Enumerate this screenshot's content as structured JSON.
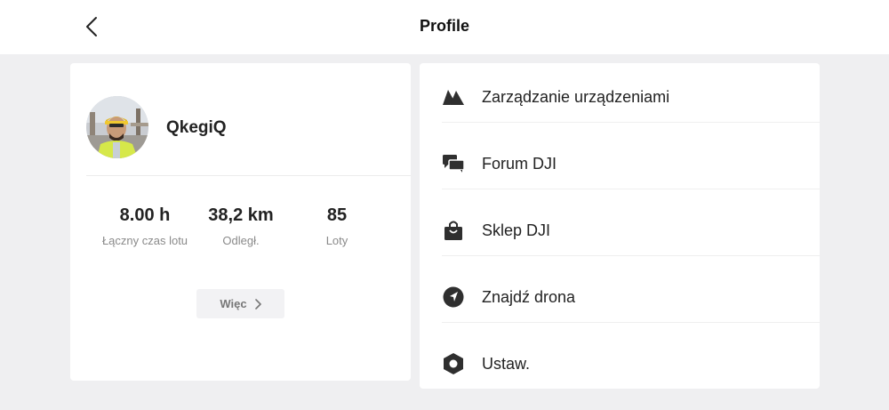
{
  "header": {
    "title": "Profile",
    "back_icon": "chevron-left-icon"
  },
  "profile": {
    "username": "QkegiQ",
    "stats": [
      {
        "value": "8.00 h",
        "label": "Łączny czas lotu"
      },
      {
        "value": "38,2 km",
        "label": "Odległ."
      },
      {
        "value": "85",
        "label": "Loty"
      }
    ],
    "more_label": "Więc"
  },
  "menu": [
    {
      "label": "Zarządzanie urządzeniami",
      "icon": "device-management-icon"
    },
    {
      "label": "Forum DJI",
      "icon": "forum-icon"
    },
    {
      "label": "Sklep DJI",
      "icon": "shopping-bag-icon"
    },
    {
      "label": "Znajdź drona",
      "icon": "find-drone-compass-icon"
    },
    {
      "label": "Ustaw.",
      "icon": "settings-hexagon-icon"
    }
  ],
  "colors": {
    "background": "#efeff1",
    "card": "#ffffff",
    "icon": "#2f2f2f",
    "muted_text": "#8a8a8a"
  }
}
